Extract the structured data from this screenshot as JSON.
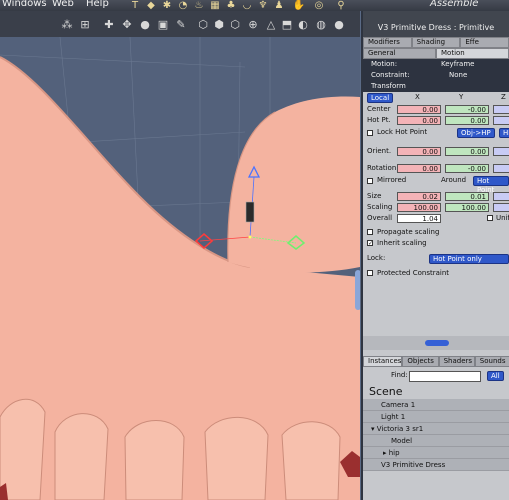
{
  "menu": {
    "windows": "Windows",
    "web": "Web",
    "help": "Help"
  },
  "top_right_tab": "Assemble",
  "panel": {
    "title": "V3 Primitive Dress : Primitive",
    "tabs": [
      "Modifiers",
      "Shading",
      "Effe"
    ],
    "subtabs": [
      "General",
      "Motion"
    ],
    "motion_label": "Motion:",
    "motion_value": "Keyframe",
    "constraint_label": "Constraint:",
    "constraint_value": "None",
    "transform_label": "Transform",
    "axis_mode": "Local",
    "axes": [
      "X",
      "Y",
      "Z"
    ],
    "center_label": "Center",
    "center_values": [
      "0.00",
      "-0.00"
    ],
    "hotpt_label": "Hot Pt.",
    "hotpt_values": [
      "0.00",
      "0.00"
    ],
    "lock_hot_point": "Lock Hot Point",
    "obj_hp_btn": "Obj->HP",
    "hp_btn": "HP",
    "orient_label": "Orient.",
    "orient_values": [
      "0.00",
      "0.00"
    ],
    "rotation_label": "Rotation",
    "rotation_values": [
      "0.00",
      "-0.00"
    ],
    "mirrored_label": "Mirrored",
    "around_label": "Around",
    "hot_point_btn": "Hot Point",
    "size_label": "Size",
    "size_values": [
      "0.02",
      "0.01"
    ],
    "scaling_label": "Scaling",
    "scaling_values": [
      "100.00",
      "100.00"
    ],
    "overall_label": "Overall",
    "overall_value": "1.04",
    "unif_label": "Unif",
    "propagate_scaling": "Propagate scaling",
    "inherit_scaling": "Inherit scaling",
    "lock_label": "Lock:",
    "lock_value": "Hot Point only",
    "protected_constraint": "Protected Constraint",
    "bottom_tabs": [
      "Instances",
      "Objects",
      "Shaders",
      "Sounds"
    ],
    "find_label": "Find:",
    "find_value": "",
    "all_btn": "All",
    "scene_label": "Scene",
    "scene_items": [
      "Camera 1",
      "Light 1",
      "Victoria 3 sr1",
      "Model",
      "hip",
      "V3 Primitive Dress"
    ]
  }
}
